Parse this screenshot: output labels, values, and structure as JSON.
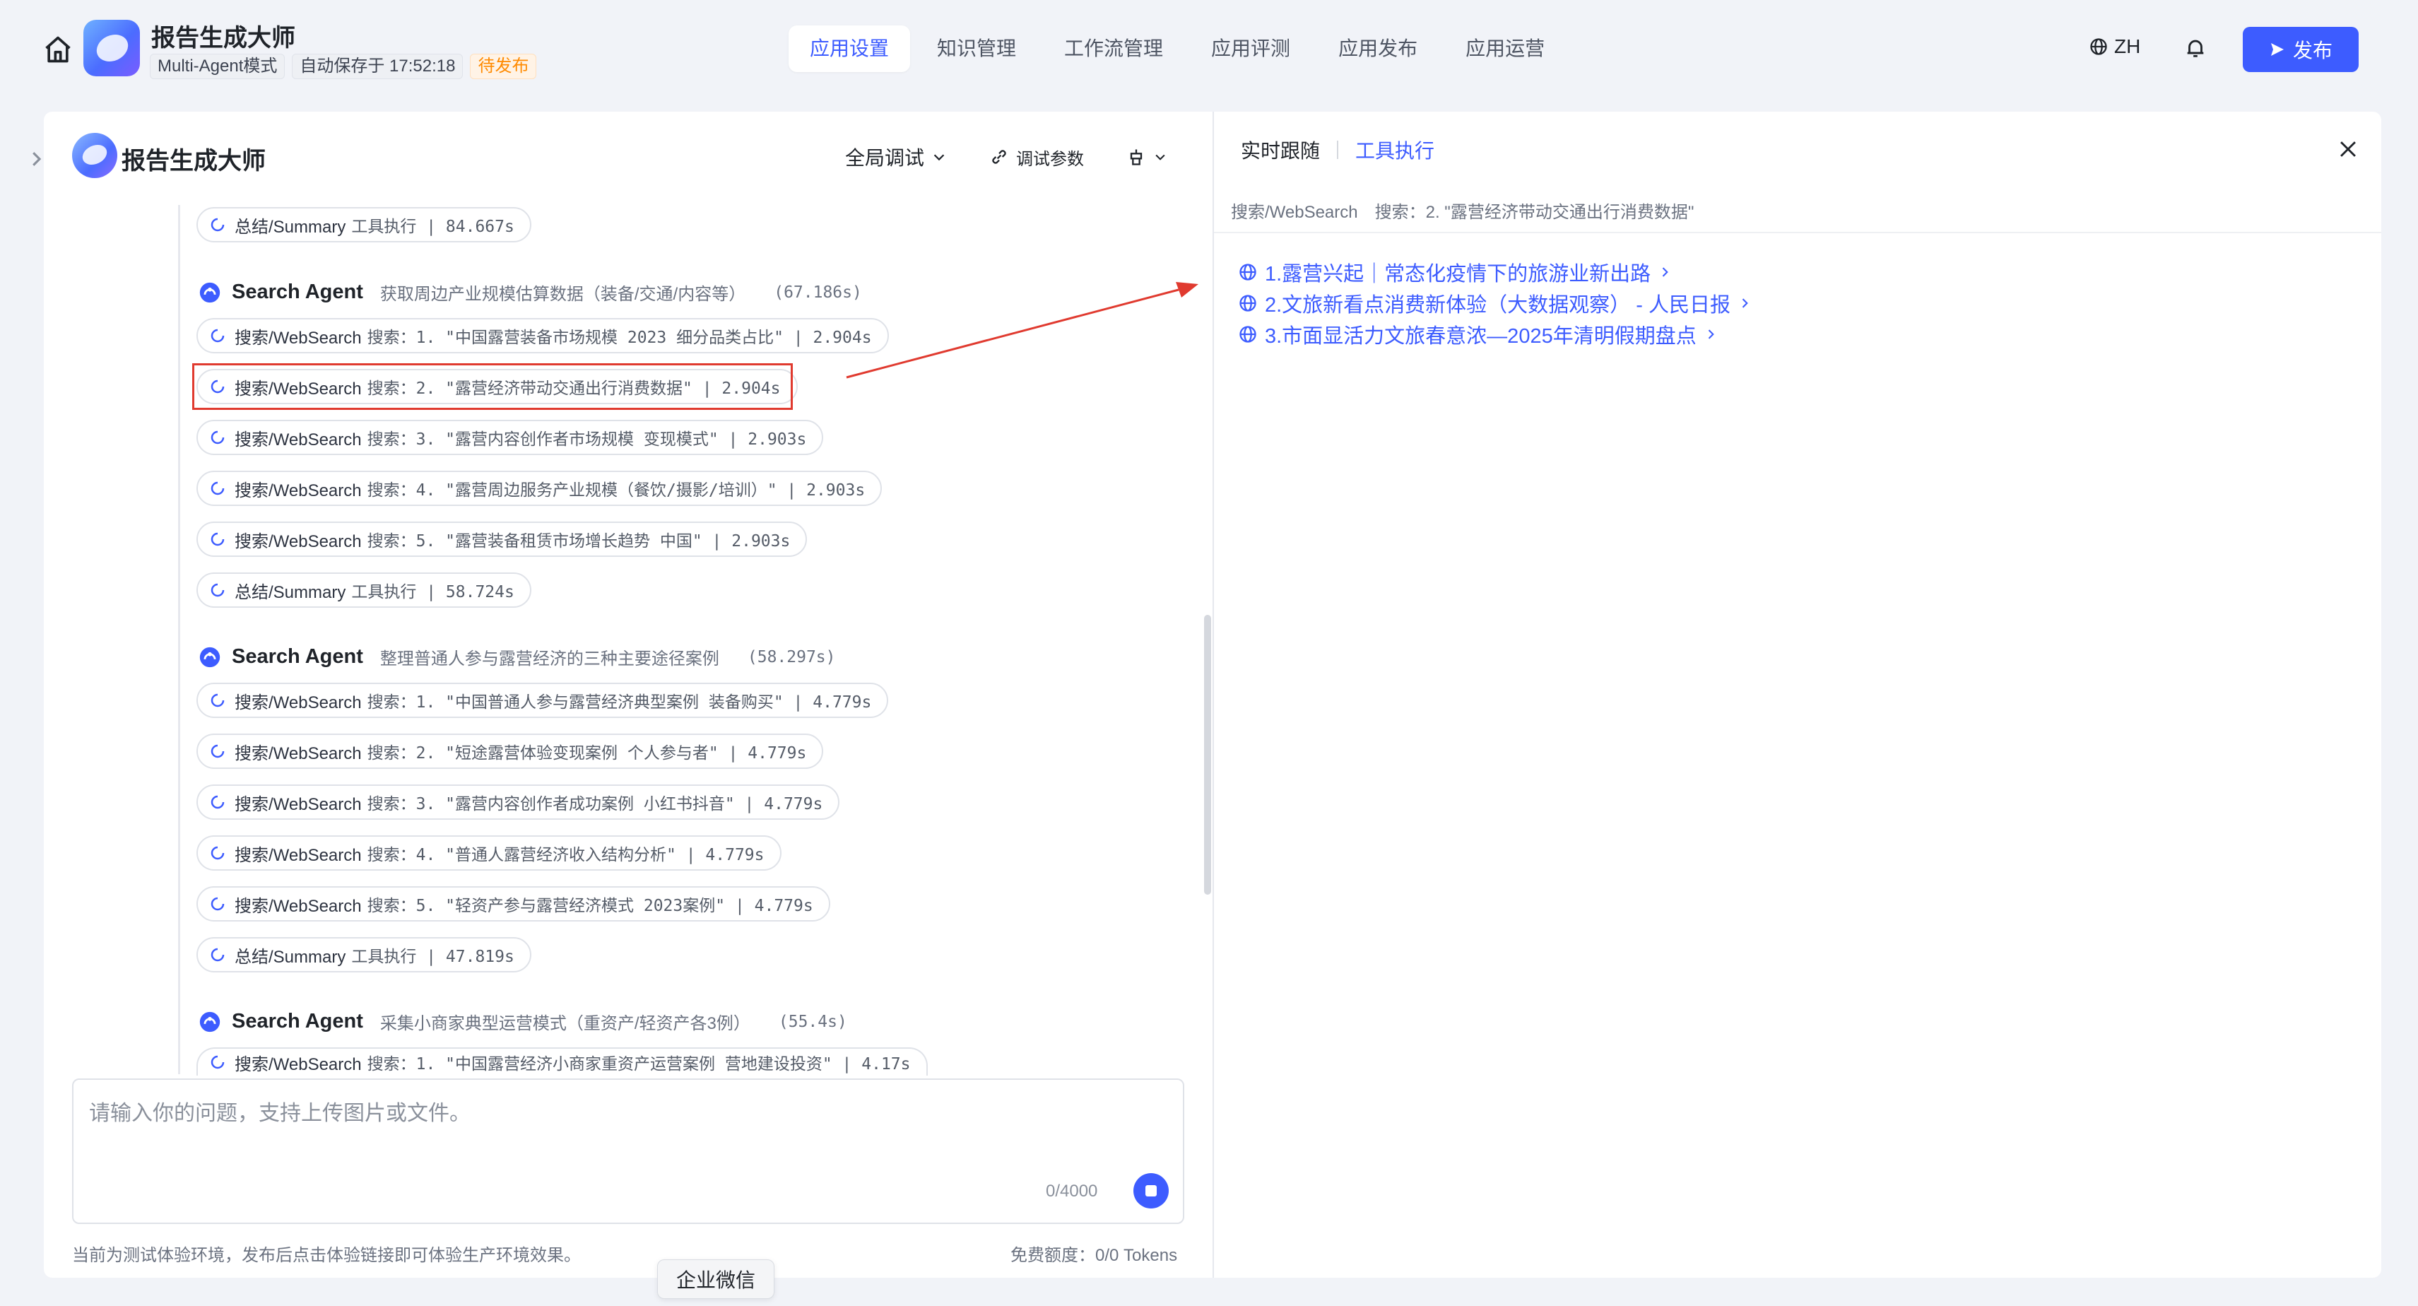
{
  "header": {
    "app_name": "报告生成大师",
    "mode_tag": "Multi-Agent模式",
    "autosave": "自动保存于 17:52:18",
    "status": "待发布",
    "tabs": [
      "应用设置",
      "知识管理",
      "工作流管理",
      "应用评测",
      "应用发布",
      "应用运营"
    ],
    "active_tab": "应用设置",
    "lang": "ZH",
    "publish_label": "发布"
  },
  "left_panel": {
    "title": "报告生成大师",
    "debug_mode": "全局调试",
    "debug_params": "调试参数",
    "input_placeholder": "请输入你的问题，支持上传图片或文件。",
    "char_counter": "0/4000",
    "footer_note": "当前为测试体验环境，发布后点击体验链接即可体验生产环境效果。",
    "quota": "免费额度：0/0 Tokens"
  },
  "trace": {
    "summary_1": {
      "tool": "总结/Summary",
      "query": "工具执行 | 84.667s"
    },
    "agent_1": {
      "name": "Search Agent",
      "desc": "获取周边产业规模估算数据（装备/交通/内容等）",
      "time": "(67.186s)"
    },
    "agent_1_calls": [
      {
        "tool": "搜索/WebSearch",
        "query": "搜索：1. \"中国露营装备市场规模 2023 细分品类占比\" | 2.904s"
      },
      {
        "tool": "搜索/WebSearch",
        "query": "搜索：2. \"露营经济带动交通出行消费数据\" | 2.904s"
      },
      {
        "tool": "搜索/WebSearch",
        "query": "搜索：3. \"露营内容创作者市场规模 变现模式\" | 2.903s"
      },
      {
        "tool": "搜索/WebSearch",
        "query": "搜索：4. \"露营周边服务产业规模（餐饮/摄影/培训）\" | 2.903s"
      },
      {
        "tool": "搜索/WebSearch",
        "query": "搜索：5. \"露营装备租赁市场增长趋势 中国\" | 2.903s"
      },
      {
        "tool": "总结/Summary",
        "query": "工具执行 | 58.724s"
      }
    ],
    "agent_2": {
      "name": "Search Agent",
      "desc": "整理普通人参与露营经济的三种主要途径案例",
      "time": "(58.297s)"
    },
    "agent_2_calls": [
      {
        "tool": "搜索/WebSearch",
        "query": "搜索：1. \"中国普通人参与露营经济典型案例 装备购买\" | 4.779s"
      },
      {
        "tool": "搜索/WebSearch",
        "query": "搜索：2. \"短途露营体验变现案例 个人参与者\" | 4.779s"
      },
      {
        "tool": "搜索/WebSearch",
        "query": "搜索：3. \"露营内容创作者成功案例 小红书抖音\" | 4.779s"
      },
      {
        "tool": "搜索/WebSearch",
        "query": "搜索：4. \"普通人露营经济收入结构分析\" | 4.779s"
      },
      {
        "tool": "搜索/WebSearch",
        "query": "搜索：5. \"轻资产参与露营经济模式 2023案例\" | 4.779s"
      },
      {
        "tool": "总结/Summary",
        "query": "工具执行 | 47.819s"
      }
    ],
    "agent_3": {
      "name": "Search Agent",
      "desc": "采集小商家典型运营模式（重资产/轻资产各3例）",
      "time": "(55.4s)"
    },
    "agent_3_calls": [
      {
        "tool": "搜索/WebSearch",
        "query": "搜索：1. \"中国露营经济小商家重资产运营案例 营地建设投资\" | 4.17s"
      }
    ]
  },
  "right_panel": {
    "tab_realtime": "实时跟随",
    "tab_tool": "工具执行",
    "tool_name": "搜索/WebSearch",
    "tool_query": "搜索：2. \"露营经济带动交通出行消费数据\"",
    "results": [
      "1.露营兴起｜常态化疫情下的旅游业新出路",
      "2.文旅新看点消费新体验（大数据观察） - 人民日报",
      "3.市面显活力文旅春意浓—2025年清明假期盘点"
    ]
  },
  "popup": {
    "label": "企业微信"
  },
  "colors": {
    "accent": "#3d5cff",
    "warning": "#ff8a00",
    "highlight": "#e03a2f"
  }
}
